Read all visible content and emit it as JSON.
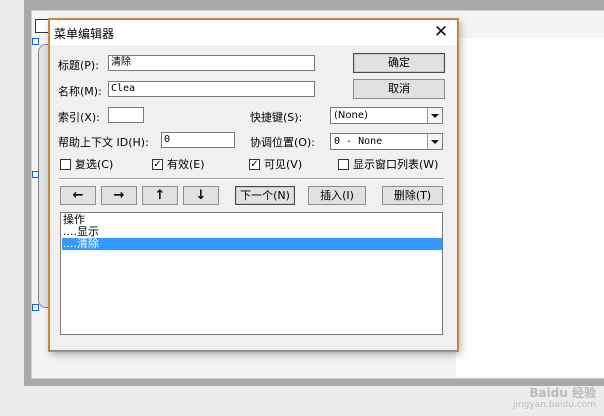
{
  "dialog": {
    "title": "菜单编辑器",
    "close_symbol": "✕"
  },
  "fields": {
    "caption_label": "标题(P):",
    "caption_value": "清除",
    "name_label": "名称(M):",
    "name_value": "Clea",
    "index_label": "索引(X):",
    "index_value": "",
    "shortcut_label": "快捷键(S):",
    "shortcut_value": "(None)",
    "helpid_label": "帮助上下文 ID(H):",
    "helpid_value": "0",
    "negotiate_label": "协调位置(O):",
    "negotiate_value": "0 - None"
  },
  "buttons": {
    "ok": "确定",
    "cancel": "取消",
    "left": "←",
    "right": "→",
    "up": "↑",
    "down": "↓",
    "next": "下一个(N)",
    "insert": "插入(I)",
    "delete": "删除(T)"
  },
  "checkboxes": {
    "checked_label": "复选(C)",
    "checked_state": false,
    "enabled_label": "有效(E)",
    "enabled_state": true,
    "visible_label": "可见(V)",
    "visible_state": true,
    "windowlist_label": "显示窗口列表(W)",
    "windowlist_state": false
  },
  "menu_list": {
    "items": [
      "操作",
      "....显示",
      "....清除"
    ],
    "selected_index": 2
  },
  "watermark": {
    "brand": "Baidu 经验",
    "url": "jingyan.baidu.com"
  },
  "colors": {
    "selection": "#3399ff",
    "window_bg": "#f0f0f0"
  }
}
